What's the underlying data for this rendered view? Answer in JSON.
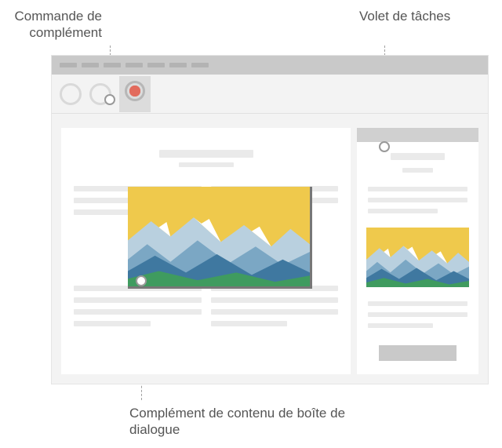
{
  "labels": {
    "addin_command": "Commande de complément",
    "task_pane": "Volet de tâches",
    "content_addin": "Complément de contenu de boîte de dialogue"
  },
  "illustration": {
    "sky": "#efc94c",
    "far_mountain": "#b9d0df",
    "mid_mountain": "#7ba7c4",
    "near_mountain": "#3f78a0",
    "snow": "#ffffff",
    "ground": "#3f9b5f",
    "sun": "#d94f3a"
  }
}
